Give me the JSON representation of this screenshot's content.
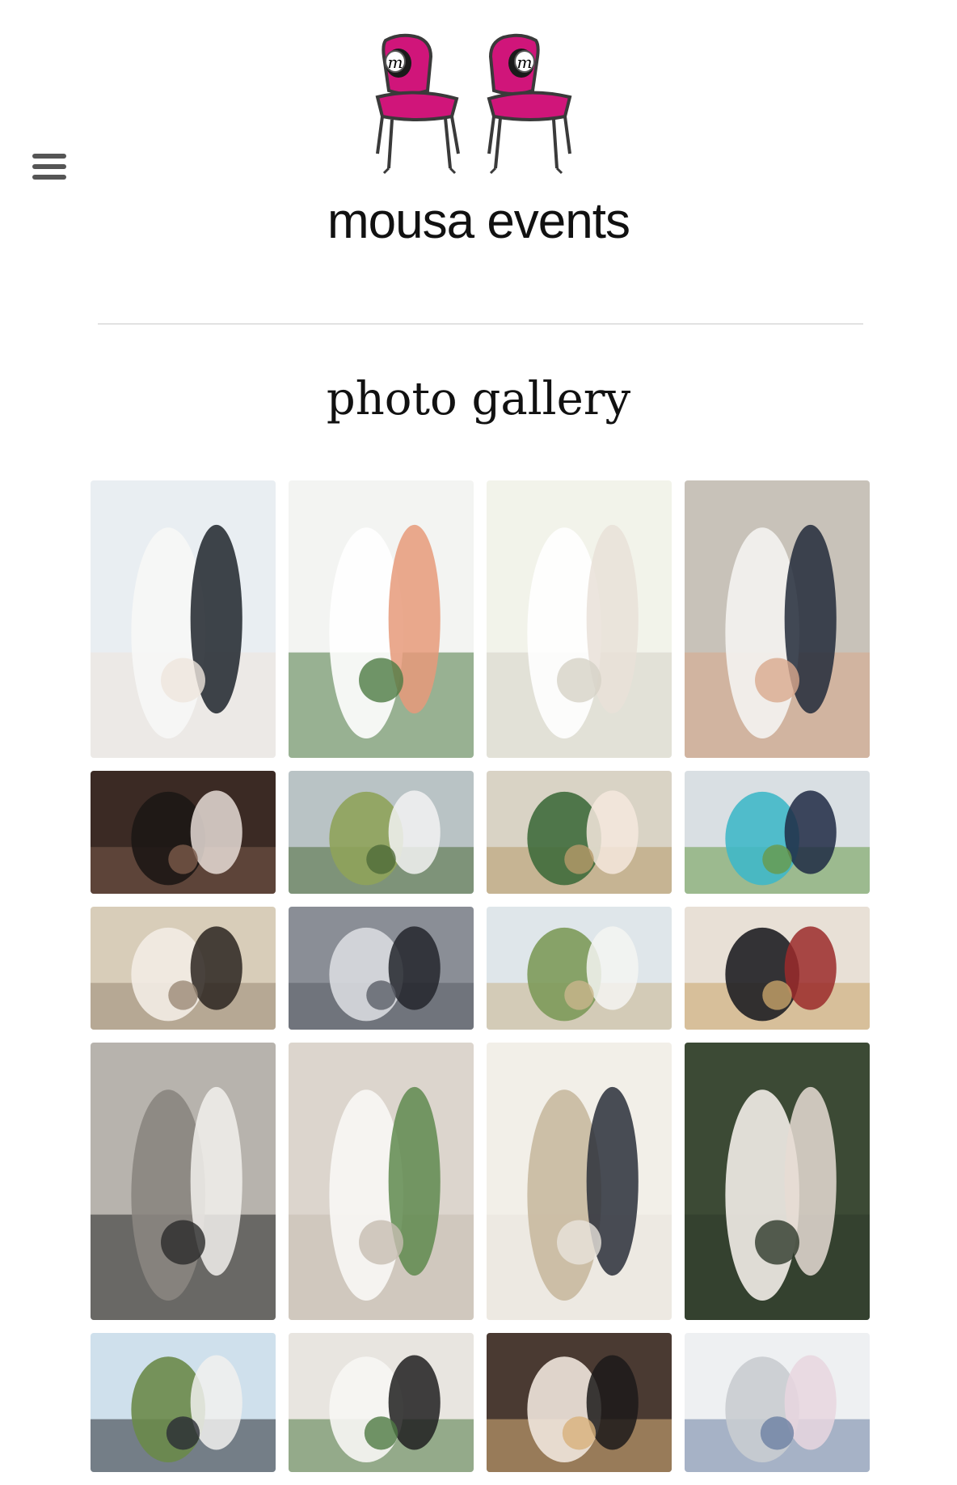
{
  "header": {
    "brand_name": "mousa events",
    "logo_monogram": "m",
    "menu_icon": "hamburger-icon"
  },
  "main": {
    "title": "photo gallery"
  },
  "gallery": {
    "rows": [
      {
        "photos": [
          {
            "name": "photo-couple-veil",
            "palette": [
              "#e9eef2",
              "#f7f7f6",
              "#1f242b",
              "#efe6dd"
            ]
          },
          {
            "name": "photo-wedding-cake",
            "palette": [
              "#f3f4f2",
              "#ffffff",
              "#e69a7a",
              "#4d7a43"
            ]
          },
          {
            "name": "photo-wedding-dress",
            "palette": [
              "#f2f3ea",
              "#ffffff",
              "#e9e0d8",
              "#d6d2c7"
            ]
          },
          {
            "name": "photo-couple-bouquet",
            "palette": [
              "#c8c2b9",
              "#f4f3f1",
              "#222a3a",
              "#d9a98d"
            ]
          }
        ]
      },
      {
        "photos": [
          {
            "name": "photo-dance-party",
            "palette": [
              "#3b2a24",
              "#1d1715",
              "#e6dcd6",
              "#7a5a4a"
            ]
          },
          {
            "name": "photo-outdoor-tables",
            "palette": [
              "#b9c3c5",
              "#8fa35a",
              "#f2f2f2",
              "#4f6b3a"
            ]
          },
          {
            "name": "photo-place-setting",
            "palette": [
              "#d9d3c5",
              "#3f6b3c",
              "#f5e7dd",
              "#b79a6a"
            ]
          },
          {
            "name": "photo-pool-tent",
            "palette": [
              "#d9dfe3",
              "#40b8c8",
              "#1f2a44",
              "#6a9a4a"
            ]
          }
        ]
      },
      {
        "photos": [
          {
            "name": "photo-bride-father",
            "palette": [
              "#d8cdb9",
              "#f3ece4",
              "#2b2520",
              "#9b8a77"
            ]
          },
          {
            "name": "photo-grand-entrance",
            "palette": [
              "#8a8e96",
              "#d8dadf",
              "#23262d",
              "#5b5f68"
            ]
          },
          {
            "name": "photo-beach-ceremony",
            "palette": [
              "#dfe6ea",
              "#7d9a5a",
              "#f4f4f2",
              "#c9b58c"
            ]
          },
          {
            "name": "photo-banquet-table",
            "palette": [
              "#e8e0d6",
              "#1f1f24",
              "#9b2a2a",
              "#c8a46a"
            ]
          }
        ]
      },
      {
        "photos": [
          {
            "name": "photo-church-steps",
            "palette": [
              "#b7b3ad",
              "#8a8580",
              "#f2f0ec",
              "#2a2a2a"
            ]
          },
          {
            "name": "photo-white-bouquet",
            "palette": [
              "#dcd5cd",
              "#f8f7f5",
              "#5f8a4f",
              "#c7bdb2"
            ]
          },
          {
            "name": "photo-chandelier-hall",
            "palette": [
              "#f2efe8",
              "#c8b9a0",
              "#2a2f3a",
              "#e9e4dc"
            ]
          },
          {
            "name": "photo-bride-tiara",
            "palette": [
              "#3c4a35",
              "#f2ede8",
              "#e6dcd3",
              "#2e3a2a"
            ]
          }
        ]
      },
      {
        "photos": [
          {
            "name": "photo-ocean-ceremony",
            "palette": [
              "#cfe0ec",
              "#6a8a4a",
              "#f1f0ee",
              "#2a2d35"
            ]
          },
          {
            "name": "photo-couple-chairs",
            "palette": [
              "#e8e5e0",
              "#f7f6f4",
              "#202020",
              "#4f7a43"
            ]
          },
          {
            "name": "photo-first-dance",
            "palette": [
              "#4a3a32",
              "#f0e6dc",
              "#1c1a1a",
              "#d8b07a"
            ]
          },
          {
            "name": "photo-shoes-perfume",
            "palette": [
              "#eef0f2",
              "#c9ccd0",
              "#e7d6df",
              "#6b7fa3"
            ]
          }
        ]
      }
    ]
  },
  "colors": {
    "logo_pink": "#d0157a",
    "logo_frame": "#4a4a4a",
    "text": "#111111",
    "divider": "#c9c9c9",
    "menu_icon": "#555555"
  }
}
